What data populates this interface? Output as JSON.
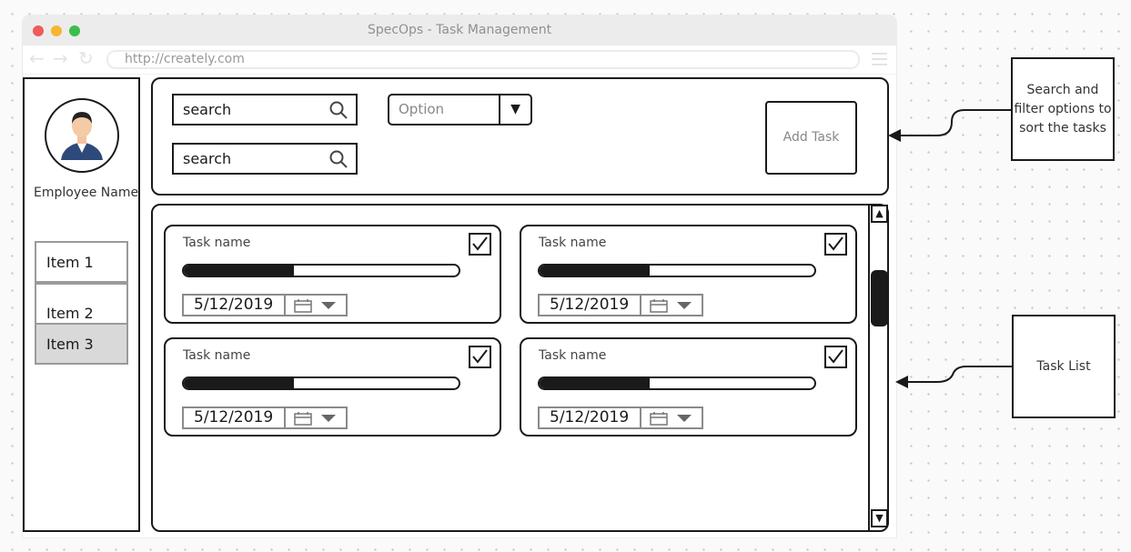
{
  "window": {
    "title": "SpecOps - Task Management",
    "url": "http://creately.com"
  },
  "sidebar": {
    "employee_name": "Employee Name",
    "items": [
      {
        "label": "Item 1",
        "selected": false
      },
      {
        "label": "Item 2",
        "selected": false
      },
      {
        "label": "Item 3",
        "selected": true
      }
    ]
  },
  "filters": {
    "search1_text": "search",
    "search2_text": "search",
    "select_value": "Option",
    "add_task_label": "Add Task"
  },
  "tasks": [
    {
      "name": "Task name",
      "progress": 0.4,
      "date": "5/12/2019",
      "checked": true
    },
    {
      "name": "Task name",
      "progress": 0.4,
      "date": "5/12/2019",
      "checked": true
    },
    {
      "name": "Task name",
      "progress": 0.4,
      "date": "5/12/2019",
      "checked": true
    },
    {
      "name": "Task name",
      "progress": 0.4,
      "date": "5/12/2019",
      "checked": true
    }
  ],
  "annotations": {
    "filters_note": "Search and filter options to sort the tasks",
    "list_note": "Task List"
  },
  "colors": {
    "outline": "#1a1a1a",
    "selected_item_bg": "#d9d9d9",
    "titlebar_bg": "#ececec",
    "traffic_red": "#f05a5a",
    "traffic_yellow": "#f5b731",
    "traffic_green": "#3dbd4a"
  },
  "icons": {
    "search": "search-icon",
    "calendar": "calendar-icon",
    "checkbox": "checkmark-icon",
    "avatar": "employee-avatar-icon"
  }
}
